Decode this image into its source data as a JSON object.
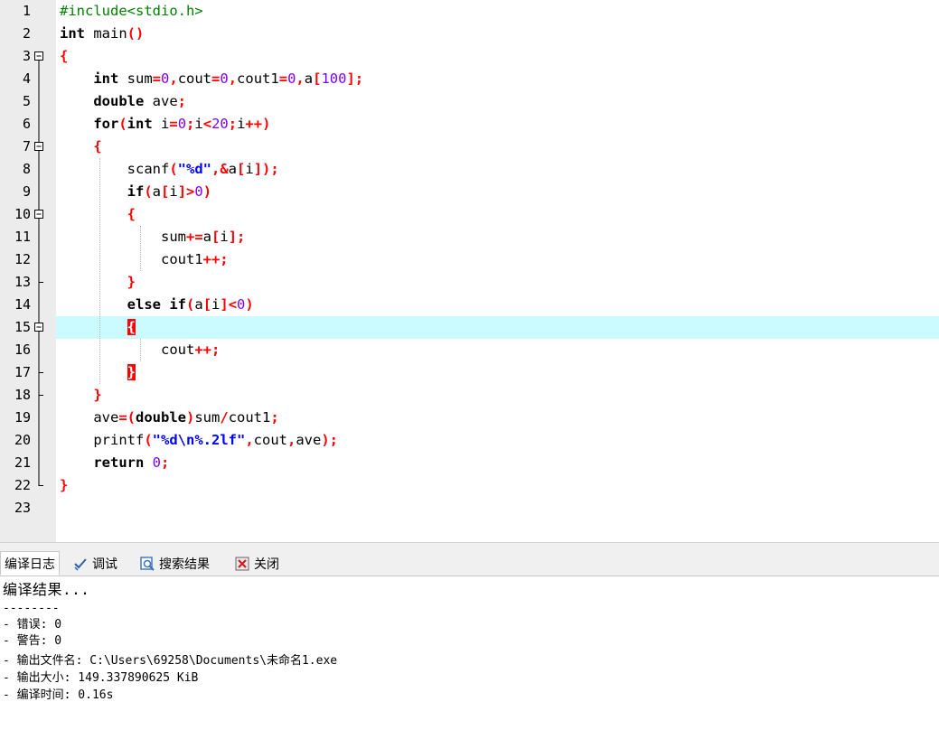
{
  "editor": {
    "current_line": 15,
    "lines": [
      {
        "n": "1",
        "fold": "none",
        "tokens": [
          [
            "pp",
            "#include<stdio.h>"
          ]
        ]
      },
      {
        "n": "2",
        "fold": "none",
        "tokens": [
          [
            "kw",
            "int"
          ],
          [
            "plain",
            " main"
          ],
          [
            "op",
            "()"
          ]
        ]
      },
      {
        "n": "3",
        "fold": "box",
        "tokens": [
          [
            "op",
            "{"
          ]
        ]
      },
      {
        "n": "4",
        "fold": "line",
        "tokens": [
          [
            "plain",
            "    "
          ],
          [
            "kw",
            "int"
          ],
          [
            "plain",
            " sum"
          ],
          [
            "op",
            "="
          ],
          [
            "num",
            "0"
          ],
          [
            "op",
            ","
          ],
          [
            "plain",
            "cout"
          ],
          [
            "op",
            "="
          ],
          [
            "num",
            "0"
          ],
          [
            "op",
            ","
          ],
          [
            "plain",
            "cout1"
          ],
          [
            "op",
            "="
          ],
          [
            "num",
            "0"
          ],
          [
            "op",
            ","
          ],
          [
            "plain",
            "a"
          ],
          [
            "op",
            "["
          ],
          [
            "num",
            "100"
          ],
          [
            "op",
            "];"
          ]
        ]
      },
      {
        "n": "5",
        "fold": "line",
        "tokens": [
          [
            "plain",
            "    "
          ],
          [
            "kw",
            "double"
          ],
          [
            "plain",
            " ave"
          ],
          [
            "op",
            ";"
          ]
        ]
      },
      {
        "n": "6",
        "fold": "line",
        "tokens": [
          [
            "plain",
            "    "
          ],
          [
            "kw",
            "for"
          ],
          [
            "op",
            "("
          ],
          [
            "kw",
            "int"
          ],
          [
            "plain",
            " i"
          ],
          [
            "op",
            "="
          ],
          [
            "num",
            "0"
          ],
          [
            "op",
            ";"
          ],
          [
            "plain",
            "i"
          ],
          [
            "op",
            "<"
          ],
          [
            "num",
            "20"
          ],
          [
            "op",
            ";"
          ],
          [
            "plain",
            "i"
          ],
          [
            "op",
            "++)"
          ]
        ]
      },
      {
        "n": "7",
        "fold": "box",
        "tokens": [
          [
            "plain",
            "    "
          ],
          [
            "op",
            "{"
          ]
        ]
      },
      {
        "n": "8",
        "fold": "line",
        "tokens": [
          [
            "plain",
            "        scanf"
          ],
          [
            "op",
            "("
          ],
          [
            "str",
            "\"%d\""
          ],
          [
            "op",
            ",&"
          ],
          [
            "plain",
            "a"
          ],
          [
            "op",
            "["
          ],
          [
            "plain",
            "i"
          ],
          [
            "op",
            "]);"
          ]
        ]
      },
      {
        "n": "9",
        "fold": "line",
        "tokens": [
          [
            "plain",
            "        "
          ],
          [
            "kw",
            "if"
          ],
          [
            "op",
            "("
          ],
          [
            "plain",
            "a"
          ],
          [
            "op",
            "["
          ],
          [
            "plain",
            "i"
          ],
          [
            "op",
            "]>"
          ],
          [
            "num",
            "0"
          ],
          [
            "op",
            ")"
          ]
        ]
      },
      {
        "n": "10",
        "fold": "box",
        "tokens": [
          [
            "plain",
            "        "
          ],
          [
            "op",
            "{"
          ]
        ]
      },
      {
        "n": "11",
        "fold": "line",
        "tokens": [
          [
            "plain",
            "            sum"
          ],
          [
            "op",
            "+="
          ],
          [
            "plain",
            "a"
          ],
          [
            "op",
            "["
          ],
          [
            "plain",
            "i"
          ],
          [
            "op",
            "];"
          ]
        ]
      },
      {
        "n": "12",
        "fold": "line",
        "tokens": [
          [
            "plain",
            "            cout1"
          ],
          [
            "op",
            "++;"
          ]
        ]
      },
      {
        "n": "13",
        "fold": "tee",
        "tokens": [
          [
            "plain",
            "        "
          ],
          [
            "op",
            "}"
          ]
        ]
      },
      {
        "n": "14",
        "fold": "line",
        "tokens": [
          [
            "plain",
            "        "
          ],
          [
            "kw",
            "else"
          ],
          [
            "plain",
            " "
          ],
          [
            "kw",
            "if"
          ],
          [
            "op",
            "("
          ],
          [
            "plain",
            "a"
          ],
          [
            "op",
            "["
          ],
          [
            "plain",
            "i"
          ],
          [
            "op",
            "]<"
          ],
          [
            "num",
            "0"
          ],
          [
            "op",
            ")"
          ]
        ]
      },
      {
        "n": "15",
        "fold": "box",
        "tokens": [
          [
            "plain",
            "        "
          ],
          [
            "hl",
            "{"
          ]
        ]
      },
      {
        "n": "16",
        "fold": "line",
        "tokens": [
          [
            "plain",
            "            cout"
          ],
          [
            "op",
            "++;"
          ]
        ]
      },
      {
        "n": "17",
        "fold": "tee",
        "tokens": [
          [
            "plain",
            "        "
          ],
          [
            "hl",
            "}"
          ]
        ]
      },
      {
        "n": "18",
        "fold": "tee",
        "tokens": [
          [
            "plain",
            "    "
          ],
          [
            "op",
            "}"
          ]
        ]
      },
      {
        "n": "19",
        "fold": "line",
        "tokens": [
          [
            "plain",
            "    ave"
          ],
          [
            "op",
            "=("
          ],
          [
            "kw",
            "double"
          ],
          [
            "op",
            ")"
          ],
          [
            "plain",
            "sum"
          ],
          [
            "op",
            "/"
          ],
          [
            "plain",
            "cout1"
          ],
          [
            "op",
            ";"
          ]
        ]
      },
      {
        "n": "20",
        "fold": "line",
        "tokens": [
          [
            "plain",
            "    printf"
          ],
          [
            "op",
            "("
          ],
          [
            "str",
            "\"%d\\n%.2lf\""
          ],
          [
            "op",
            ","
          ],
          [
            "plain",
            "cout"
          ],
          [
            "op",
            ","
          ],
          [
            "plain",
            "ave"
          ],
          [
            "op",
            ");"
          ]
        ]
      },
      {
        "n": "21",
        "fold": "line",
        "tokens": [
          [
            "plain",
            "    "
          ],
          [
            "kw",
            "return"
          ],
          [
            "plain",
            " "
          ],
          [
            "num",
            "0"
          ],
          [
            "op",
            ";"
          ]
        ]
      },
      {
        "n": "22",
        "fold": "end",
        "tokens": [
          [
            "op",
            "}"
          ]
        ]
      },
      {
        "n": "23",
        "fold": "none",
        "tokens": []
      }
    ]
  },
  "tabs": [
    {
      "label": "编译日志",
      "icon": "none",
      "active": true
    },
    {
      "label": "调试",
      "icon": "check-icon",
      "active": false
    },
    {
      "label": "搜索结果",
      "icon": "search-results-icon",
      "active": false
    },
    {
      "label": "关闭",
      "icon": "close-panel-icon",
      "active": false
    }
  ],
  "log": {
    "lines": [
      "编译结果...",
      "--------",
      "- 错误: 0",
      "- 警告: 0",
      "- 输出文件名: C:\\Users\\69258\\Documents\\未命名1.exe",
      "- 输出大小: 149.337890625 KiB",
      "- 编译时间: 0.16s"
    ]
  },
  "colors": {
    "keyword": "#000000",
    "operator": "#ff0000",
    "number": "#8000ff",
    "string": "#0000ff",
    "preprocessor": "#008000",
    "current_line": "#ccfbff",
    "gutter": "#ececec"
  }
}
